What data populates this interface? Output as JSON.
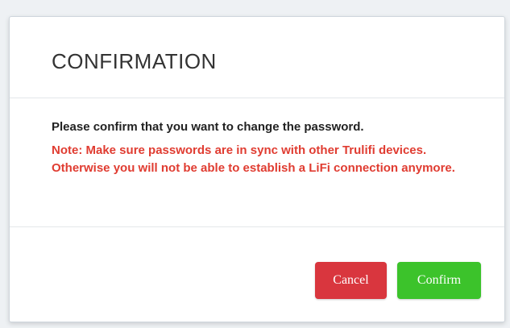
{
  "dialog": {
    "title": "CONFIRMATION",
    "message": "Please confirm that you want to change the password.",
    "note": "Note: Make sure passwords are in sync with other Trulifi devices. Otherwise you will not be able to establish a LiFi connection anymore.",
    "buttons": {
      "cancel_label": "Cancel",
      "confirm_label": "Confirm"
    },
    "colors": {
      "note_text": "#e03c31",
      "cancel_bg": "#d9363e",
      "confirm_bg": "#3cc32b"
    }
  }
}
